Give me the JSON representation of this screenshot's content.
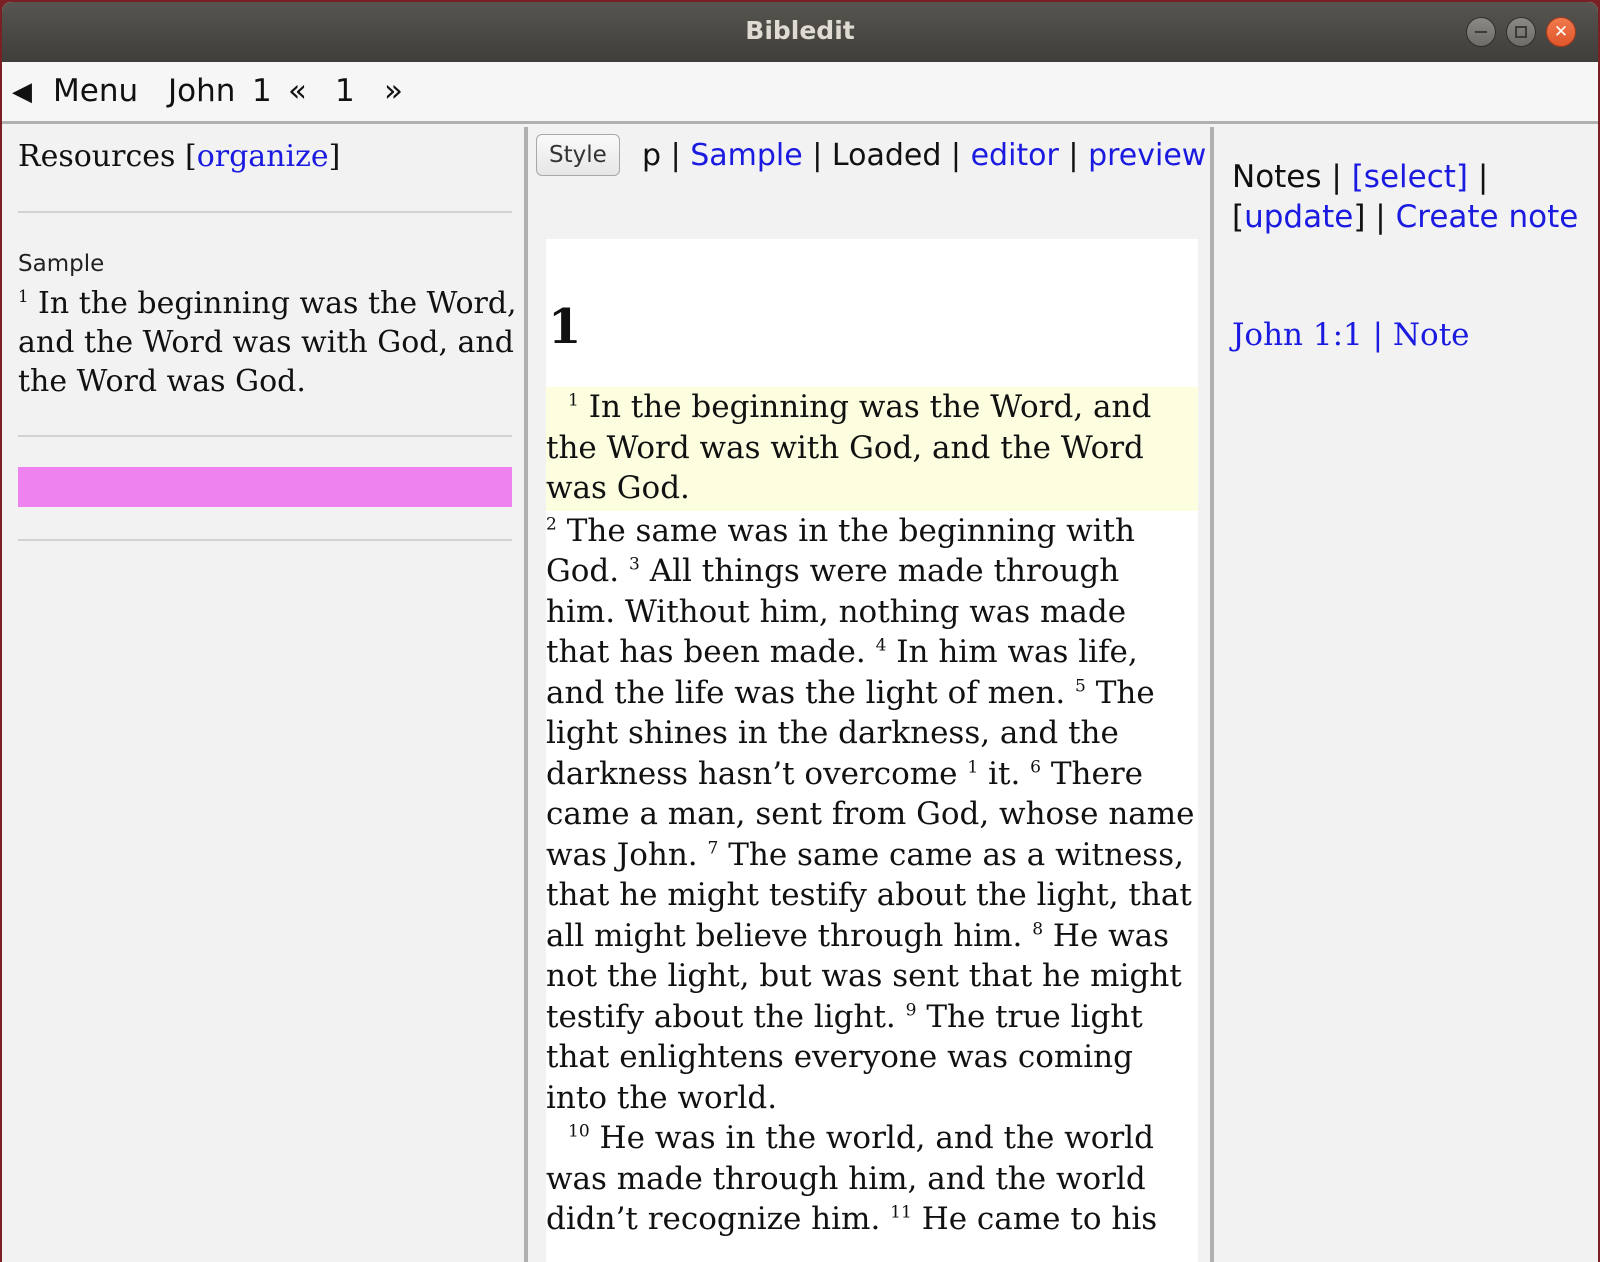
{
  "window": {
    "title": "Bibledit"
  },
  "menubar": {
    "back_arrow": "◀",
    "menu_label": "Menu",
    "book": "John",
    "chapter": "1",
    "prev": "«",
    "chapter_select": "1",
    "next": "»"
  },
  "resources": {
    "label": "Resources",
    "bracket_open": "[",
    "organize_link": "organize",
    "bracket_close": "]",
    "items": [
      {
        "title": "Sample",
        "verse_num": "1",
        "text": "In the beginning was the Word, and the Word was with God, and the Word was God."
      }
    ],
    "highlight_color": "#ee82ee"
  },
  "editor_toolbar": {
    "style_button": "Style",
    "style_value": "p",
    "sep1": " | ",
    "bible_link": "Sample",
    "sep2": " | ",
    "status": "Loaded",
    "sep3": " | ",
    "editor_link": "editor",
    "sep4": " | ",
    "preview_link": "preview"
  },
  "editor": {
    "chapter_number": "1",
    "highlight_color": "#fdfde0",
    "verses": {
      "v1_num": "1",
      "v1": "In the beginning was the Word, and the Word was with God, and the Word was God.",
      "v2_num": "2",
      "v2": "The same was in the beginning with God.",
      "v3_num": "3",
      "v3": "All things were made through him. Without him, nothing was made that has been made.",
      "v4_num": "4",
      "v4": "In him was life, and the life was the light of men.",
      "v5_num": "5",
      "v5": "The light shines in the darkness, and the darkness hasn’t overcome",
      "fn1_num": "1",
      "v5b": "it.",
      "v6_num": "6",
      "v6": "There came a man, sent from God, whose name was John.",
      "v7_num": "7",
      "v7": "The same came as a witness, that he might testify about the light, that all might believe through him.",
      "v8_num": "8",
      "v8": "He was not the light, but was sent that he might testify about the light.",
      "v9_num": "9",
      "v9": "The true light that enlightens everyone was coming into the world.",
      "v10_num": "10",
      "v10": "He was in the world, and the world was made through him, and the world didn’t recognize him.",
      "v11_num": "11",
      "v11": "He came to his"
    }
  },
  "notes": {
    "label": "Notes",
    "sep1": " | ",
    "select_link": "[select]",
    "sep2": " |",
    "bracket_open": "[",
    "update_link": "update",
    "bracket_close": "]",
    "sep3": " | ",
    "create_link": "Create note",
    "items": [
      {
        "text": "John 1:1 | Note"
      }
    ]
  },
  "colors": {
    "link": "#1a1ae0",
    "accent_close": "#e0562b"
  }
}
